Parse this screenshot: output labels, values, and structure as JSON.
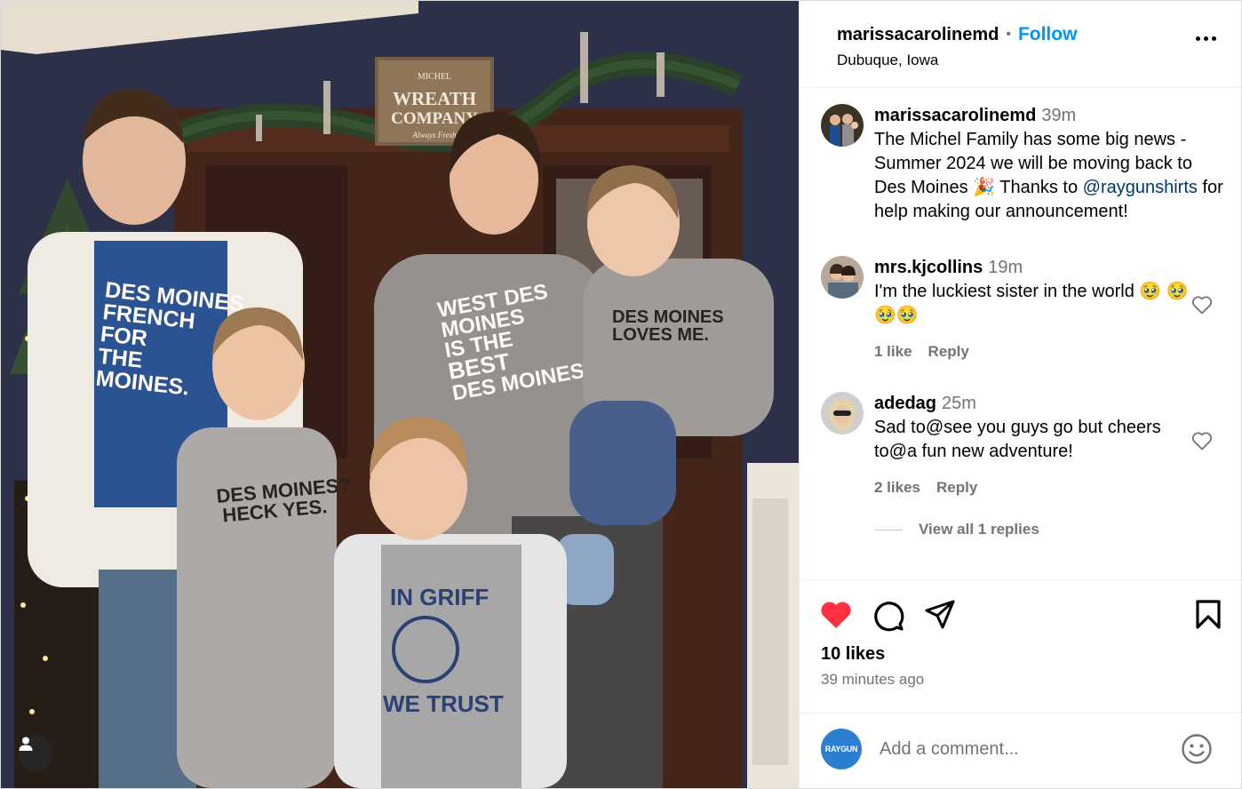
{
  "post": {
    "username": "marissacarolinemd",
    "separator": "•",
    "follow_label": "Follow",
    "location": "Dubuque, Iowa"
  },
  "caption": {
    "username": "marissacarolinemd",
    "time": "39m",
    "text_1": "The Michel Family has some big news - Summer 2024 we will be moving back to Des Moines 🎉 Thanks to ",
    "mention": "@raygunshirts",
    "text_2": " for help making our announcement!"
  },
  "comments": [
    {
      "username": "mrs.kjcollins",
      "time": "19m",
      "text": "I'm the luckiest sister in the world 🥹 🥹🥹🥹",
      "likes": "1 like",
      "reply_label": "Reply"
    },
    {
      "username": "adedag",
      "time": "25m",
      "text": "Sad to@see you guys go but cheers to@a fun new adventure!",
      "likes": "2 likes",
      "reply_label": "Reply"
    }
  ],
  "view_replies": "View all 1 replies",
  "actions": {
    "likes": "10 likes",
    "posted": "39 minutes ago"
  },
  "add_comment": {
    "avatar_text": "RAYGUN",
    "placeholder": "Add a comment..."
  },
  "photo": {
    "sign_top": "MICHEL",
    "sign_main_1": "WREATH",
    "sign_main_2": "COMPANY",
    "sign_bottom": "Always Fresh",
    "shirt_dad": [
      "DES MOINES",
      "FRENCH",
      "FOR",
      "THE",
      "MOINES."
    ],
    "shirt_mom": [
      "WEST DES",
      "MOINES",
      "IS THE",
      "BEST",
      "DES MOINES"
    ],
    "shirt_toddler": [
      "DES MOINES",
      "LOVES ME."
    ],
    "shirt_boy1": [
      "DES MOINES?",
      "HECK YES."
    ],
    "shirt_boy2": [
      "IN GRIFF",
      "WE TRUST"
    ]
  },
  "colors": {
    "accent": "#0095f6",
    "like": "#ff3040",
    "mention": "#00376b",
    "muted": "#737373"
  }
}
